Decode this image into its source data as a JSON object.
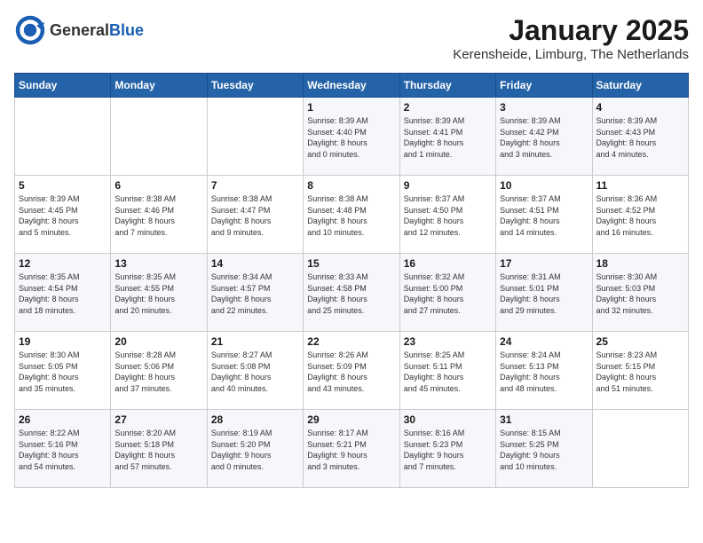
{
  "header": {
    "logo_general": "General",
    "logo_blue": "Blue",
    "title": "January 2025",
    "subtitle": "Kerensheide, Limburg, The Netherlands"
  },
  "weekdays": [
    "Sunday",
    "Monday",
    "Tuesday",
    "Wednesday",
    "Thursday",
    "Friday",
    "Saturday"
  ],
  "weeks": [
    [
      {
        "day": "",
        "info": ""
      },
      {
        "day": "",
        "info": ""
      },
      {
        "day": "",
        "info": ""
      },
      {
        "day": "1",
        "info": "Sunrise: 8:39 AM\nSunset: 4:40 PM\nDaylight: 8 hours\nand 0 minutes."
      },
      {
        "day": "2",
        "info": "Sunrise: 8:39 AM\nSunset: 4:41 PM\nDaylight: 8 hours\nand 1 minute."
      },
      {
        "day": "3",
        "info": "Sunrise: 8:39 AM\nSunset: 4:42 PM\nDaylight: 8 hours\nand 3 minutes."
      },
      {
        "day": "4",
        "info": "Sunrise: 8:39 AM\nSunset: 4:43 PM\nDaylight: 8 hours\nand 4 minutes."
      }
    ],
    [
      {
        "day": "5",
        "info": "Sunrise: 8:39 AM\nSunset: 4:45 PM\nDaylight: 8 hours\nand 5 minutes."
      },
      {
        "day": "6",
        "info": "Sunrise: 8:38 AM\nSunset: 4:46 PM\nDaylight: 8 hours\nand 7 minutes."
      },
      {
        "day": "7",
        "info": "Sunrise: 8:38 AM\nSunset: 4:47 PM\nDaylight: 8 hours\nand 9 minutes."
      },
      {
        "day": "8",
        "info": "Sunrise: 8:38 AM\nSunset: 4:48 PM\nDaylight: 8 hours\nand 10 minutes."
      },
      {
        "day": "9",
        "info": "Sunrise: 8:37 AM\nSunset: 4:50 PM\nDaylight: 8 hours\nand 12 minutes."
      },
      {
        "day": "10",
        "info": "Sunrise: 8:37 AM\nSunset: 4:51 PM\nDaylight: 8 hours\nand 14 minutes."
      },
      {
        "day": "11",
        "info": "Sunrise: 8:36 AM\nSunset: 4:52 PM\nDaylight: 8 hours\nand 16 minutes."
      }
    ],
    [
      {
        "day": "12",
        "info": "Sunrise: 8:35 AM\nSunset: 4:54 PM\nDaylight: 8 hours\nand 18 minutes."
      },
      {
        "day": "13",
        "info": "Sunrise: 8:35 AM\nSunset: 4:55 PM\nDaylight: 8 hours\nand 20 minutes."
      },
      {
        "day": "14",
        "info": "Sunrise: 8:34 AM\nSunset: 4:57 PM\nDaylight: 8 hours\nand 22 minutes."
      },
      {
        "day": "15",
        "info": "Sunrise: 8:33 AM\nSunset: 4:58 PM\nDaylight: 8 hours\nand 25 minutes."
      },
      {
        "day": "16",
        "info": "Sunrise: 8:32 AM\nSunset: 5:00 PM\nDaylight: 8 hours\nand 27 minutes."
      },
      {
        "day": "17",
        "info": "Sunrise: 8:31 AM\nSunset: 5:01 PM\nDaylight: 8 hours\nand 29 minutes."
      },
      {
        "day": "18",
        "info": "Sunrise: 8:30 AM\nSunset: 5:03 PM\nDaylight: 8 hours\nand 32 minutes."
      }
    ],
    [
      {
        "day": "19",
        "info": "Sunrise: 8:30 AM\nSunset: 5:05 PM\nDaylight: 8 hours\nand 35 minutes."
      },
      {
        "day": "20",
        "info": "Sunrise: 8:28 AM\nSunset: 5:06 PM\nDaylight: 8 hours\nand 37 minutes."
      },
      {
        "day": "21",
        "info": "Sunrise: 8:27 AM\nSunset: 5:08 PM\nDaylight: 8 hours\nand 40 minutes."
      },
      {
        "day": "22",
        "info": "Sunrise: 8:26 AM\nSunset: 5:09 PM\nDaylight: 8 hours\nand 43 minutes."
      },
      {
        "day": "23",
        "info": "Sunrise: 8:25 AM\nSunset: 5:11 PM\nDaylight: 8 hours\nand 45 minutes."
      },
      {
        "day": "24",
        "info": "Sunrise: 8:24 AM\nSunset: 5:13 PM\nDaylight: 8 hours\nand 48 minutes."
      },
      {
        "day": "25",
        "info": "Sunrise: 8:23 AM\nSunset: 5:15 PM\nDaylight: 8 hours\nand 51 minutes."
      }
    ],
    [
      {
        "day": "26",
        "info": "Sunrise: 8:22 AM\nSunset: 5:16 PM\nDaylight: 8 hours\nand 54 minutes."
      },
      {
        "day": "27",
        "info": "Sunrise: 8:20 AM\nSunset: 5:18 PM\nDaylight: 8 hours\nand 57 minutes."
      },
      {
        "day": "28",
        "info": "Sunrise: 8:19 AM\nSunset: 5:20 PM\nDaylight: 9 hours\nand 0 minutes."
      },
      {
        "day": "29",
        "info": "Sunrise: 8:17 AM\nSunset: 5:21 PM\nDaylight: 9 hours\nand 3 minutes."
      },
      {
        "day": "30",
        "info": "Sunrise: 8:16 AM\nSunset: 5:23 PM\nDaylight: 9 hours\nand 7 minutes."
      },
      {
        "day": "31",
        "info": "Sunrise: 8:15 AM\nSunset: 5:25 PM\nDaylight: 9 hours\nand 10 minutes."
      },
      {
        "day": "",
        "info": ""
      }
    ]
  ]
}
